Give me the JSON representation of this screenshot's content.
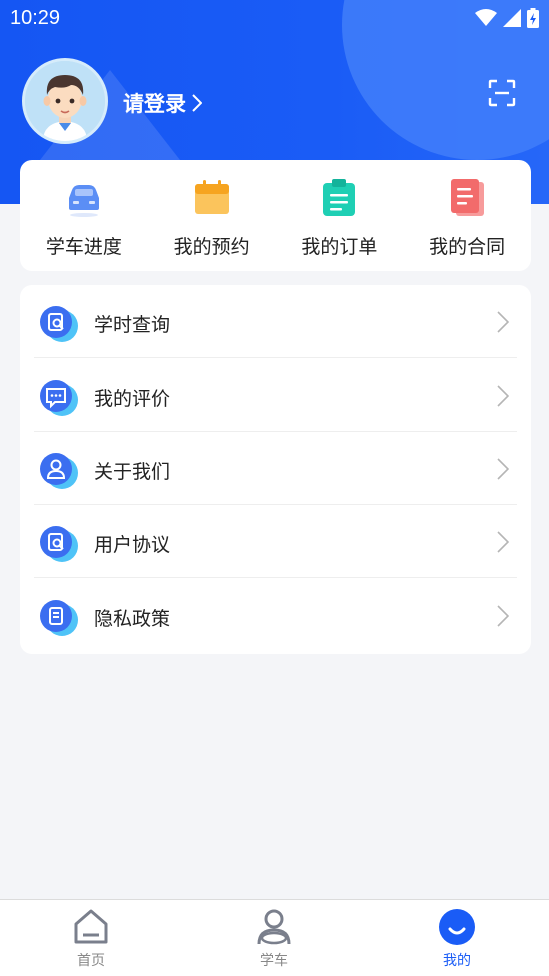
{
  "status_bar": {
    "time": "10:29"
  },
  "profile": {
    "login_text": "请登录"
  },
  "quick_actions": [
    {
      "label": "学车进度",
      "icon": "car-icon",
      "color": "#5b8ef5"
    },
    {
      "label": "我的预约",
      "icon": "calendar-icon",
      "color": "#f8b33a"
    },
    {
      "label": "我的订单",
      "icon": "clipboard-icon",
      "color": "#1fcfb4"
    },
    {
      "label": "我的合同",
      "icon": "document-icon",
      "color": "#f26b6b"
    }
  ],
  "menu": [
    {
      "label": "学时查询",
      "icon": "hours-search-icon"
    },
    {
      "label": "我的评价",
      "icon": "comment-icon"
    },
    {
      "label": "关于我们",
      "icon": "user-icon"
    },
    {
      "label": "用户协议",
      "icon": "agreement-icon"
    },
    {
      "label": "隐私政策",
      "icon": "privacy-icon"
    }
  ],
  "tabs": [
    {
      "label": "首页",
      "icon": "home-icon",
      "active": false
    },
    {
      "label": "学车",
      "icon": "driver-icon",
      "active": false
    },
    {
      "label": "我的",
      "icon": "smile-icon",
      "active": true
    }
  ],
  "colors": {
    "primary": "#1a5cf6",
    "accent_light": "#3f7cf9"
  }
}
